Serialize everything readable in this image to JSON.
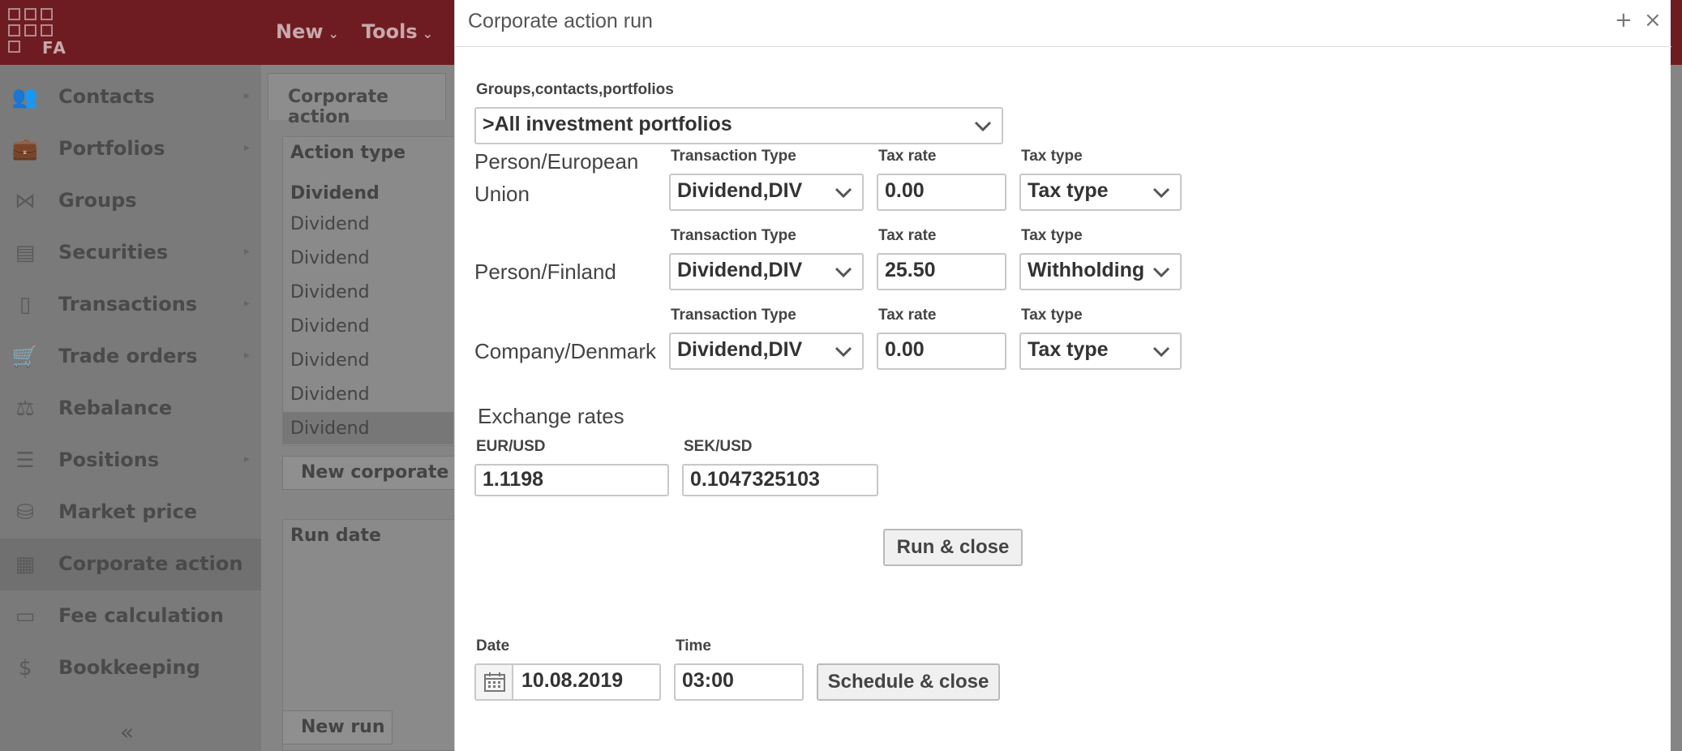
{
  "app": {
    "logo_text": "FA",
    "menu": [
      {
        "label": "New"
      },
      {
        "label": "Tools"
      }
    ]
  },
  "sidebar": {
    "items": [
      {
        "label": "Contacts",
        "icon": "contacts-icon",
        "has_arrow": true
      },
      {
        "label": "Portfolios",
        "icon": "portfolio-icon",
        "has_arrow": true
      },
      {
        "label": "Groups",
        "icon": "share-icon",
        "has_arrow": false
      },
      {
        "label": "Securities",
        "icon": "securities-icon",
        "has_arrow": true
      },
      {
        "label": "Transactions",
        "icon": "document-icon",
        "has_arrow": true
      },
      {
        "label": "Trade orders",
        "icon": "cart-icon",
        "has_arrow": true
      },
      {
        "label": "Rebalance",
        "icon": "scale-icon",
        "has_arrow": false
      },
      {
        "label": "Positions",
        "icon": "list-icon",
        "has_arrow": true
      },
      {
        "label": "Market price",
        "icon": "coins-icon",
        "has_arrow": false
      },
      {
        "label": "Corporate action",
        "icon": "building-icon",
        "has_arrow": false,
        "active": true
      },
      {
        "label": "Fee calculation",
        "icon": "receipt-icon",
        "has_arrow": false
      },
      {
        "label": "Bookkeeping",
        "icon": "ledger-icon",
        "has_arrow": false
      }
    ],
    "collapse": "«"
  },
  "background": {
    "tab": "Corporate action",
    "column_header": "Action type",
    "filter_value": "Dividend",
    "rows": [
      "Dividend",
      "Dividend",
      "Dividend",
      "Dividend",
      "Dividend",
      "Dividend",
      "Dividend"
    ],
    "new_corporate_button": "New corporate ac",
    "run_date_header": "Run date",
    "new_run_button": "New run"
  },
  "modal": {
    "title": "Corporate action run",
    "target_label": "Groups,contacts,portfolios",
    "target_value": ">All investment portfolios",
    "tax_rows": [
      {
        "name_line1": "Person/European",
        "name_line2": "Union",
        "transaction_type_label": "Transaction Type",
        "transaction_type": "Dividend,DIV",
        "tax_rate_label": "Tax rate",
        "tax_rate": "0.00",
        "tax_type_label": "Tax type",
        "tax_type": "Tax type"
      },
      {
        "name_line1": "Person/Finland",
        "name_line2": "",
        "transaction_type_label": "Transaction Type",
        "transaction_type": "Dividend,DIV",
        "tax_rate_label": "Tax rate",
        "tax_rate": "25.50",
        "tax_type_label": "Tax type",
        "tax_type": "Withholding"
      },
      {
        "name_line1": "Company/Denmark",
        "name_line2": "",
        "transaction_type_label": "Transaction Type",
        "transaction_type": "Dividend,DIV",
        "tax_rate_label": "Tax rate",
        "tax_rate": "0.00",
        "tax_type_label": "Tax type",
        "tax_type": "Tax type"
      }
    ],
    "exchange_rates": {
      "heading": "Exchange rates",
      "pairs": [
        {
          "label": "EUR/USD",
          "value": "1.1198"
        },
        {
          "label": "SEK/USD",
          "value": "0.1047325103"
        }
      ]
    },
    "run_close_button": "Run & close",
    "schedule": {
      "date_label": "Date",
      "date_value": "10.08.2019",
      "time_label": "Time",
      "time_value": "03:00",
      "button": "Schedule & close"
    }
  }
}
